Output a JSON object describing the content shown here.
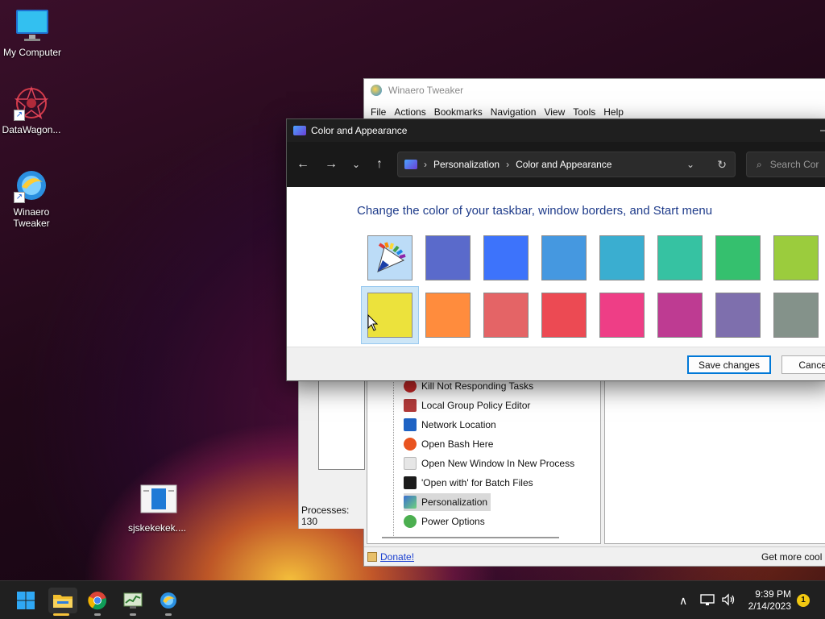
{
  "desktop": {
    "icons": [
      {
        "label": "My Computer",
        "icon": "monitor-icon"
      },
      {
        "label": "DataWagon...",
        "icon": "datawagon-icon"
      },
      {
        "label": "Winaero Tweaker",
        "icon": "winaero-icon"
      },
      {
        "label": "sjskekekek....",
        "icon": "document-icon"
      }
    ]
  },
  "winaero": {
    "title": "Winaero Tweaker",
    "menu": [
      "File",
      "Actions",
      "Bookmarks",
      "Navigation",
      "View",
      "Tools",
      "Help"
    ],
    "tree_items": [
      {
        "label": "Kill Not Responding Tasks",
        "icon": "red-x-icon",
        "color": "#c62828"
      },
      {
        "label": "Local Group Policy Editor",
        "icon": "policy-icon",
        "color": "#b23a3a"
      },
      {
        "label": "Network Location",
        "icon": "network-icon",
        "color": "#1e63c4"
      },
      {
        "label": "Open Bash Here",
        "icon": "ubuntu-icon",
        "color": "#e95420"
      },
      {
        "label": "Open New Window In New Process",
        "icon": "window-icon",
        "color": "#d0d0d0"
      },
      {
        "label": "'Open with' for Batch Files",
        "icon": "batch-icon",
        "color": "#1b1b1b"
      },
      {
        "label": "Personalization",
        "icon": "personalization-icon",
        "color": "#3b6fd1"
      },
      {
        "label": "Power Options",
        "icon": "power-icon",
        "color": "#4caf50"
      }
    ],
    "selected_item": "Personalization",
    "donate": "Donate!",
    "status_right": "Get more cool"
  },
  "taskmgr": {
    "processes": "Processes: 130"
  },
  "color_window": {
    "title": "Color and Appearance",
    "breadcrumb": [
      "Personalization",
      "Color and Appearance"
    ],
    "search_placeholder": "Search Cor",
    "heading": "Change the color of your taskbar, window borders, and Start menu",
    "colors_row1": [
      "palette",
      "#5a6acb",
      "#3d73fb",
      "#4598e0",
      "#3aaed0",
      "#36c2a2",
      "#35c06e",
      "#9bcc3d"
    ],
    "colors_row2": [
      "#ece23c",
      "#ff8c3d",
      "#e46466",
      "#ec4a53",
      "#ee3e86",
      "#be3b92",
      "#7e6fad",
      "#84928a"
    ],
    "selected_color": "#ece23c",
    "save_label": "Save changes",
    "cancel_label": "Cancel"
  },
  "taskbar": {
    "apps": [
      "start-icon",
      "file-explorer-icon",
      "chrome-icon",
      "task-manager-icon",
      "winaero-tweaker-icon"
    ],
    "time": "9:39 PM",
    "date": "2/14/2023",
    "notification_count": "1"
  }
}
